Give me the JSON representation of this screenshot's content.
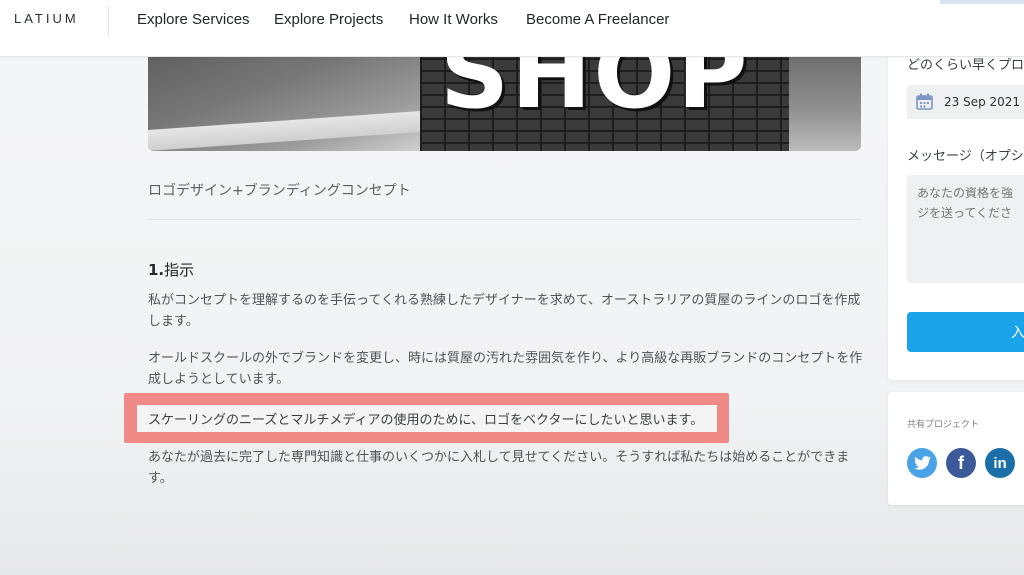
{
  "nav": {
    "logo": "LATIUM",
    "links": [
      "Explore Services",
      "Explore Projects",
      "How It Works",
      "Become A Freelancer"
    ]
  },
  "hero": {
    "sign_text": "SHOP"
  },
  "project": {
    "subtitle": "ロゴデザイン+ブランディングコンセプト",
    "section_number": "1.",
    "section_title": "指示",
    "paragraphs": [
      "私がコンセプトを理解するのを手伝ってくれる熟練したデザイナーを求めて、オーストラリアの質屋のラインのロゴを作成します。",
      "オールドスクールの外でブランドを変更し、時には質屋の汚れた雰囲気を作り、より高級な再販ブランドのコンセプトを作成しようとしています。",
      "スケーリングのニーズとマルチメディアの使用のために、ロゴをベクターにしたいと思います。",
      "あなたが過去に完了した専門知識と仕事のいくつかに入札して見せてください。そうすれば私たちは始めることができます。"
    ]
  },
  "sidebar": {
    "delivery_label": "どのくらい早くプロ",
    "date_value": "23 Sep 2021",
    "message_label": "メッセージ（オプシ",
    "message_placeholder": "あなたの資格を強\nジを送ってくださ",
    "submit_label": "入",
    "share_label": "共有プロジェクト",
    "social": [
      {
        "name": "twitter-icon",
        "glyph": ""
      },
      {
        "name": "facebook-icon",
        "glyph": "f"
      },
      {
        "name": "linkedin-icon",
        "glyph": "in"
      }
    ]
  },
  "colors": {
    "highlight": "#f08a86",
    "primary_button": "#1aa3e8",
    "twitter": "#4aa3e6",
    "facebook": "#3c5a99",
    "linkedin": "#1c6fa6"
  }
}
